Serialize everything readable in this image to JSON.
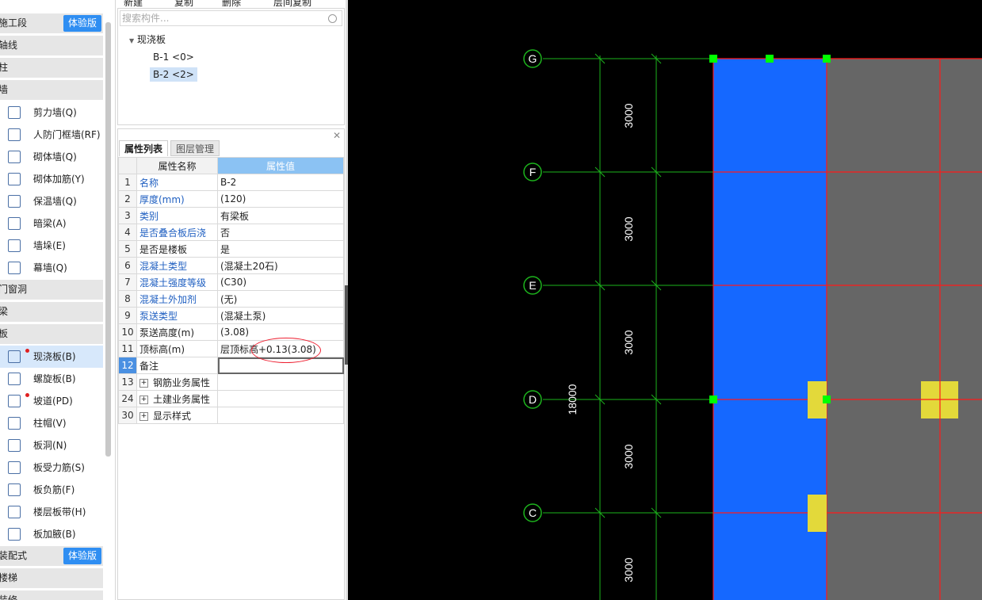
{
  "toolbar": {
    "new": "新建",
    "copy": "复制",
    "delete": "删除",
    "floor_copy": "层间复制"
  },
  "sidebar": {
    "categories": [
      {
        "label": "施工段",
        "badge": "体验版"
      },
      {
        "label": "轴线"
      },
      {
        "label": "柱"
      },
      {
        "label": "墙"
      },
      {
        "label": "门窗洞"
      },
      {
        "label": "梁"
      },
      {
        "label": "板"
      },
      {
        "label": "装配式",
        "badge": "体验版"
      },
      {
        "label": "楼梯"
      },
      {
        "label": "装修"
      }
    ],
    "wall_items": [
      "剪力墙(Q)",
      "人防门框墙(RF)",
      "砌体墙(Q)",
      "砌体加筋(Y)",
      "保温墙(Q)",
      "暗梁(A)",
      "墙垛(E)",
      "幕墙(Q)"
    ],
    "slab_items": [
      "现浇板(B)",
      "螺旋板(B)",
      "坡道(PD)",
      "柱帽(V)",
      "板洞(N)",
      "板受力筋(S)",
      "板负筋(F)",
      "楼层板带(H)",
      "板加腋(B)"
    ]
  },
  "component_list": {
    "search_placeholder": "搜索构件...",
    "group": "现浇板",
    "items": [
      "B-1 <0>",
      "B-2 <2>"
    ]
  },
  "properties": {
    "tabs": [
      "属性列表",
      "图层管理"
    ],
    "header_name": "属性名称",
    "header_value": "属性值",
    "rows": [
      {
        "n": "1",
        "name": "名称",
        "value": "B-2",
        "blue": true
      },
      {
        "n": "2",
        "name": "厚度(mm)",
        "value": "(120)",
        "blue": true
      },
      {
        "n": "3",
        "name": "类别",
        "value": "有梁板",
        "blue": true
      },
      {
        "n": "4",
        "name": "是否叠合板后浇",
        "value": "否",
        "blue": true
      },
      {
        "n": "5",
        "name": "是否是楼板",
        "value": "是",
        "blue": false
      },
      {
        "n": "6",
        "name": "混凝土类型",
        "value": "(混凝土20石)",
        "blue": true
      },
      {
        "n": "7",
        "name": "混凝土强度等级",
        "value": "(C30)",
        "blue": true
      },
      {
        "n": "8",
        "name": "混凝土外加剂",
        "value": "(无)",
        "blue": true
      },
      {
        "n": "9",
        "name": "泵送类型",
        "value": "(混凝土泵)",
        "blue": true
      },
      {
        "n": "10",
        "name": "泵送高度(m)",
        "value": "(3.08)",
        "blue": false
      },
      {
        "n": "11",
        "name": "顶标高(m)",
        "value": "层顶标高+0.13(3.08)",
        "blue": false
      },
      {
        "n": "12",
        "name": "备注",
        "value": "",
        "blue": false
      },
      {
        "n": "13",
        "name": "钢筋业务属性",
        "value": "",
        "group": true
      },
      {
        "n": "24",
        "name": "土建业务属性",
        "value": "",
        "group": true
      },
      {
        "n": "30",
        "name": "显示样式",
        "value": "",
        "group": true
      }
    ]
  },
  "cad": {
    "axes": [
      "G",
      "F",
      "E",
      "D",
      "C"
    ],
    "segment_dims": [
      "3000",
      "3000",
      "3000",
      "3000",
      "3000"
    ],
    "total_dim": "18000",
    "colors": {
      "slab_blue": "#1568ff",
      "slab_gray": "#666666",
      "grid_green": "#1db31d",
      "beam_red": "#ff1a1a",
      "column_yellow": "#e3d93a",
      "grip_green": "#00ff00"
    }
  }
}
